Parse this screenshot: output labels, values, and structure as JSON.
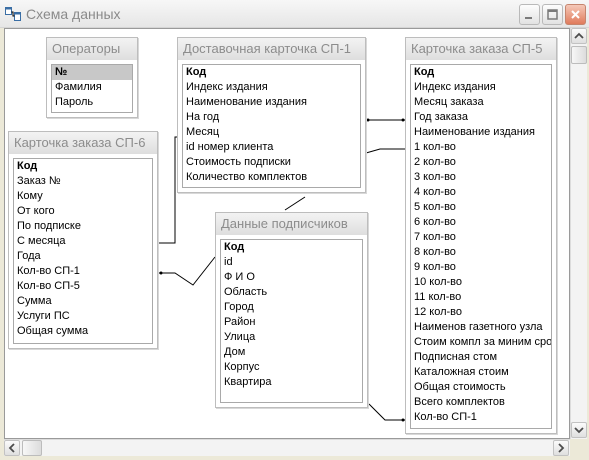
{
  "window": {
    "title": "Схема данных"
  },
  "tables": {
    "operators": {
      "title": "Операторы",
      "fields": [
        {
          "name": "№",
          "key": true
        },
        {
          "name": "Фамилия",
          "key": false
        },
        {
          "name": "Пароль",
          "key": false
        }
      ]
    },
    "delivery_card": {
      "title": "Доставочная карточка СП-1",
      "fields": [
        {
          "name": "Код",
          "key": true
        },
        {
          "name": "Индекс издания",
          "key": false
        },
        {
          "name": "Наименование издания",
          "key": false
        },
        {
          "name": "На год",
          "key": false
        },
        {
          "name": "Месяц",
          "key": false
        },
        {
          "name": "id номер клиента",
          "key": false
        },
        {
          "name": "Стоимость подписки",
          "key": false
        },
        {
          "name": "Количество комплектов",
          "key": false
        }
      ]
    },
    "order_card_sp5": {
      "title": "Карточка заказа СП-5",
      "fields": [
        {
          "name": "Код",
          "key": true
        },
        {
          "name": "Индекс издания",
          "key": false
        },
        {
          "name": "Месяц заказа",
          "key": false
        },
        {
          "name": "Год заказа",
          "key": false
        },
        {
          "name": "Наименование издания",
          "key": false
        },
        {
          "name": "1 кол-во",
          "key": false
        },
        {
          "name": "2 кол-во",
          "key": false
        },
        {
          "name": "3 кол-во",
          "key": false
        },
        {
          "name": "4 кол-во",
          "key": false
        },
        {
          "name": "5 кол-во",
          "key": false
        },
        {
          "name": "6 кол-во",
          "key": false
        },
        {
          "name": "7 кол-во",
          "key": false
        },
        {
          "name": "8 кол-во",
          "key": false
        },
        {
          "name": "9 кол-во",
          "key": false
        },
        {
          "name": "10 кол-во",
          "key": false
        },
        {
          "name": "11 кол-во",
          "key": false
        },
        {
          "name": "12 кол-во",
          "key": false
        },
        {
          "name": "Наименов газетного узла",
          "key": false
        },
        {
          "name": "Стоим компл за миним срок",
          "key": false
        },
        {
          "name": "Подписная стом",
          "key": false
        },
        {
          "name": "Каталожная стоим",
          "key": false
        },
        {
          "name": "Общая стоимость",
          "key": false
        },
        {
          "name": "Всего комплектов",
          "key": false
        },
        {
          "name": "Кол-во СП-1",
          "key": false
        }
      ]
    },
    "order_card_sp6": {
      "title": "Карточка заказа СП-6",
      "fields": [
        {
          "name": "Код",
          "key": true
        },
        {
          "name": "Заказ №",
          "key": false
        },
        {
          "name": "Кому",
          "key": false
        },
        {
          "name": "От кого",
          "key": false
        },
        {
          "name": "По подписке",
          "key": false
        },
        {
          "name": "С месяца",
          "key": false
        },
        {
          "name": "Года",
          "key": false
        },
        {
          "name": "Кол-во СП-1",
          "key": false
        },
        {
          "name": "Кол-во СП-5",
          "key": false
        },
        {
          "name": "Сумма",
          "key": false
        },
        {
          "name": "Услуги ПС",
          "key": false
        },
        {
          "name": "Общая сумма",
          "key": false
        }
      ]
    },
    "subscribers": {
      "title": "Данные подписчиков",
      "fields": [
        {
          "name": "Код",
          "key": true
        },
        {
          "name": "id",
          "key": false
        },
        {
          "name": "Ф И О",
          "key": false
        },
        {
          "name": "Область",
          "key": false
        },
        {
          "name": "Город",
          "key": false
        },
        {
          "name": "Район",
          "key": false
        },
        {
          "name": "Улица",
          "key": false
        },
        {
          "name": "Дом",
          "key": false
        },
        {
          "name": "Корпус",
          "key": false
        },
        {
          "name": "Квартира",
          "key": false
        }
      ]
    }
  },
  "selected_field": "operators.0",
  "icons": {
    "app": "relationships-icon",
    "minimize": "minimize-icon",
    "maximize": "maximize-icon",
    "close": "close-icon",
    "scroll_up": "arrow-up-icon",
    "scroll_down": "arrow-down-icon",
    "scroll_left": "arrow-left-icon",
    "scroll_right": "arrow-right-icon"
  }
}
